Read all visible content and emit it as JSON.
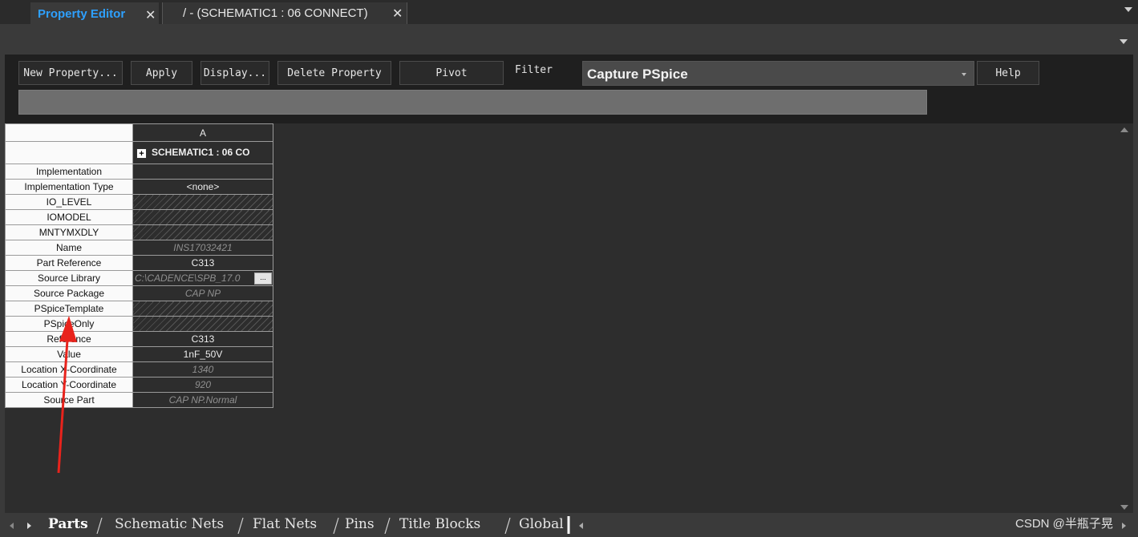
{
  "tabs": [
    {
      "label": "Property Editor",
      "active": true
    },
    {
      "label": "/ - (SCHEMATIC1 : 06 CONNECT)",
      "active": false
    }
  ],
  "toolbar": {
    "new_property": "New Property...",
    "apply": "Apply",
    "display": "Display...",
    "delete_property": "Delete Property",
    "pivot": "Pivot",
    "filter_label": "Filter",
    "filter_value": "Capture PSpice",
    "help": "Help"
  },
  "grid": {
    "column_header": "A",
    "title": "SCHEMATIC1 : 06 CO",
    "expander": "+",
    "browse_label": "...",
    "rows": [
      {
        "label": "Implementation",
        "value": "",
        "style": "normal"
      },
      {
        "label": "Implementation Type",
        "value": "<none>",
        "style": "normal"
      },
      {
        "label": "IO_LEVEL",
        "value": "",
        "style": "hatch"
      },
      {
        "label": "IOMODEL",
        "value": "",
        "style": "hatch"
      },
      {
        "label": "MNTYMXDLY",
        "value": "",
        "style": "hatch"
      },
      {
        "label": "Name",
        "value": "INS17032421",
        "style": "readonly"
      },
      {
        "label": "Part Reference",
        "value": "C313",
        "style": "normal"
      },
      {
        "label": "Source Library",
        "value": "C:\\CADENCE\\SPB_17.0",
        "style": "library"
      },
      {
        "label": "Source Package",
        "value": "CAP NP",
        "style": "readonly"
      },
      {
        "label": "PSpiceTemplate",
        "value": "",
        "style": "hatch"
      },
      {
        "label": "PSpiceOnly",
        "value": "",
        "style": "hatch"
      },
      {
        "label": "Reference",
        "value": "C313",
        "style": "normal"
      },
      {
        "label": "Value",
        "value": "1nF_50V",
        "style": "normal"
      },
      {
        "label": "Location X-Coordinate",
        "value": "1340",
        "style": "readonly"
      },
      {
        "label": "Location Y-Coordinate",
        "value": "920",
        "style": "readonly"
      },
      {
        "label": "Source Part",
        "value": "CAP NP.Normal",
        "style": "readonly"
      }
    ]
  },
  "sheet_tabs": [
    {
      "label": "Parts",
      "active": true
    },
    {
      "label": "Schematic Nets",
      "active": false
    },
    {
      "label": "Flat Nets",
      "active": false
    },
    {
      "label": "Pins",
      "active": false
    },
    {
      "label": "Title Blocks",
      "active": false
    },
    {
      "label": "Global",
      "active": false
    }
  ],
  "watermark": "CSDN @半瓶子晃",
  "colors": {
    "accent_tab": "#2ea0ff",
    "annotation_arrow": "#e8231c",
    "background": "#2d2d2d"
  }
}
